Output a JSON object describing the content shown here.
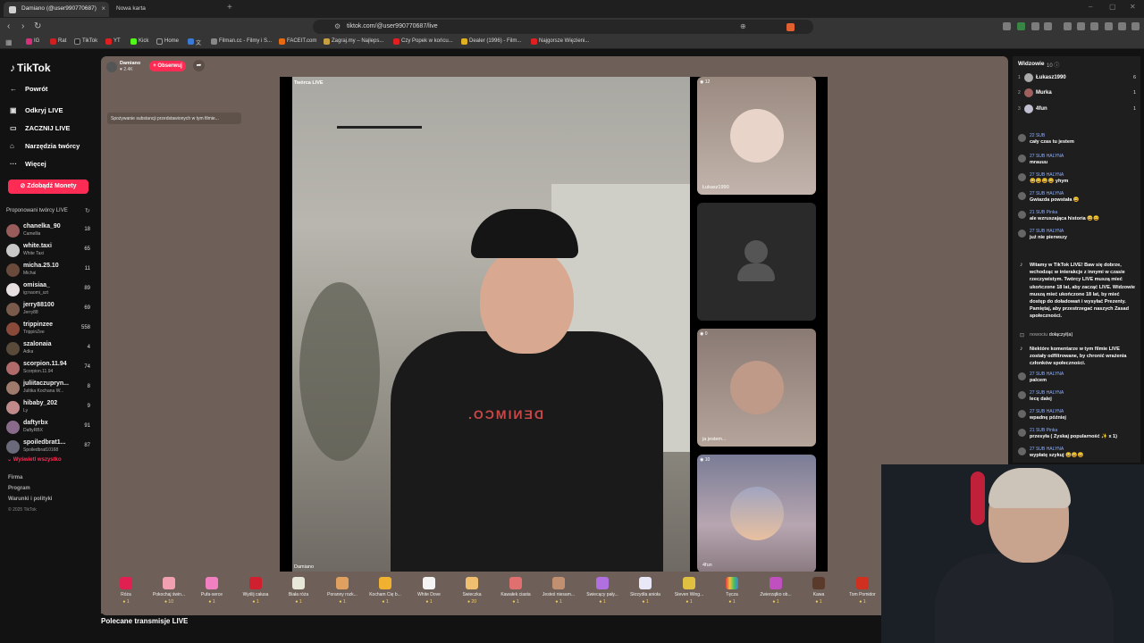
{
  "browser": {
    "tabs": [
      {
        "label": "Damiano (@user990770687)"
      },
      {
        "label": "Nowa karta"
      }
    ],
    "url": "tiktok.com/@user990770687/live",
    "bookmarks": [
      "IG",
      "Rat",
      "TikTok",
      "YT",
      "Kick",
      "Home",
      "文",
      "Filman.cc - Filmy i S...",
      "FACEIT.com",
      "Zagraj.my – Najleps...",
      "Czy Popek w końcu...",
      "Dealer (1996) - Film...",
      "Najgorsze Więzieni..."
    ]
  },
  "sidebar": {
    "logo": "TikTok",
    "nav": [
      {
        "label": "Powrót"
      },
      {
        "label": "Odkryj LIVE"
      },
      {
        "label": "ZACZNIJ LIVE"
      },
      {
        "label": "Narzędzia twórcy"
      },
      {
        "label": "Więcej"
      }
    ],
    "coins_button": "Zdobądź Monety",
    "suggested_title": "Proponowani twórcy LIVE",
    "creators": [
      {
        "name": "chanelka_90",
        "sub": "Camellia",
        "count": "18"
      },
      {
        "name": "white.taxi",
        "sub": "White Taxi",
        "count": "65"
      },
      {
        "name": "micha.25.10",
        "sub": "Michał",
        "count": "11"
      },
      {
        "name": "omisiaa_",
        "sub": "ig:naomi_szt",
        "count": "89"
      },
      {
        "name": "jerry88100",
        "sub": "Jerry88",
        "count": "69"
      },
      {
        "name": "trippinzee",
        "sub": "TrippinZee",
        "count": "558"
      },
      {
        "name": "szalonaia",
        "sub": "Adka",
        "count": "4"
      },
      {
        "name": "scorpion.11.94",
        "sub": "Scorpion.11.94",
        "count": "74"
      },
      {
        "name": "juliitaczupryn...",
        "sub": "Julitka Kochana W...",
        "count": "8"
      },
      {
        "name": "hibaby_202",
        "sub": "Ly",
        "count": "9"
      },
      {
        "name": "daftyrbx",
        "sub": "DaftyRBX",
        "count": "91"
      },
      {
        "name": "spoiledbrat1...",
        "sub": "Spoiledbrat10168",
        "count": "87"
      }
    ],
    "show_all": "Wyświetl wszystko",
    "footer": [
      "Firma",
      "Program",
      "Warunki i polityki"
    ],
    "copyright": "© 2025 TikTok"
  },
  "stage": {
    "host_name": "Damiano",
    "host_likes": "2.4K",
    "follow_button": "Obserwuj",
    "warning": "Spożywanie substancji przedstawionych w tym filmie...",
    "creator_badge": "Twórca LIVE",
    "creator_label": "Damiano",
    "shirt_text": "DENIMCO.",
    "guests": [
      {
        "count": "12",
        "name": "Łukasz1990"
      },
      {
        "count": "",
        "name": ""
      },
      {
        "count": "0",
        "name": "ja jestem..."
      },
      {
        "count": "10",
        "name": "4fun"
      }
    ]
  },
  "gifts": [
    {
      "name": "Róża",
      "price": "1"
    },
    {
      "name": "Pokochaj świn...",
      "price": "10"
    },
    {
      "name": "Pufa-serce",
      "price": "1"
    },
    {
      "name": "Wyślij całusa",
      "price": "1"
    },
    {
      "name": "Biała róża",
      "price": "1"
    },
    {
      "name": "Poranny rozk...",
      "price": "1"
    },
    {
      "name": "Kocham Cię b...",
      "price": "1"
    },
    {
      "name": "White Dove",
      "price": "1"
    },
    {
      "name": "Świeczka",
      "price": "20"
    },
    {
      "name": "Kawałek ciasta",
      "price": "1"
    },
    {
      "name": "Jesteś niesam...",
      "price": "1"
    },
    {
      "name": "Świecący pały...",
      "price": "1"
    },
    {
      "name": "Skrzydła anioła",
      "price": "1"
    },
    {
      "name": "Steven Wing...",
      "price": "1"
    },
    {
      "name": "Tęcza",
      "price": "1"
    },
    {
      "name": "Zwierzątko ob...",
      "price": "1"
    },
    {
      "name": "Kawa",
      "price": "1"
    },
    {
      "name": "Tom Pomidor",
      "price": "1"
    }
  ],
  "recommended": "Polecane transmisje LIVE",
  "chat": {
    "viewers_title": "Widzowie",
    "viewers_count": "10",
    "top_viewers": [
      {
        "rank": "1",
        "name": "Łukasz1990",
        "count": "6"
      },
      {
        "rank": "2",
        "name": "Murka",
        "count": "1"
      },
      {
        "rank": "3",
        "name": "4fun",
        "count": "1"
      }
    ],
    "messages": [
      {
        "badge": "22 SUB",
        "text": "cały czas tu jestem"
      },
      {
        "badge": "27 SUB HALYNA",
        "text": "mrauuu"
      },
      {
        "badge": "27 SUB HALYNA",
        "text": "😄😄😄😄 yhym"
      },
      {
        "badge": "27 SUB HALYNA",
        "text": "Gwiazda powstała 😄"
      },
      {
        "badge": "21 SUB Pinka",
        "text": "ale wzruszająca historia 😄😄"
      },
      {
        "badge": "27 SUB HALYNA",
        "text": "już nie pierwszy"
      }
    ],
    "welcome": "Witamy w TikTok LIVE! Baw się dobrze, wchodząc w interakcje z innymi w czasie rzeczywistym. Twórcy LIVE muszą mieć ukończone 18 lat, aby zacząć LIVE. Widzowie muszą mieć ukończone 18 lat, by mieć dostęp do doładowań i wysyłać Prezenty. Pamiętaj, aby przestrzegać naszych Zasad społeczności.",
    "joined_user": "nowociu",
    "joined_text": "dołączył(a)",
    "filtered": "Niektóre komentarze w tym filmie LIVE zostały odfiltrowane, by chronić wrażenia członków społeczności.",
    "messages2": [
      {
        "badge": "27 SUB HALYNA",
        "text": "palcem"
      },
      {
        "badge": "27 SUB HALYNA",
        "text": "lecę dalej"
      },
      {
        "badge": "27 SUB HALYNA",
        "text": "wpadnę później"
      },
      {
        "badge": "21 SUB Pinka",
        "text": "przesyła ( Zyskaj popularność ✨ x 1)"
      },
      {
        "badge": "27 SUB HALYNA",
        "text": "wypłatę szykuj 😄😄😄"
      }
    ]
  }
}
